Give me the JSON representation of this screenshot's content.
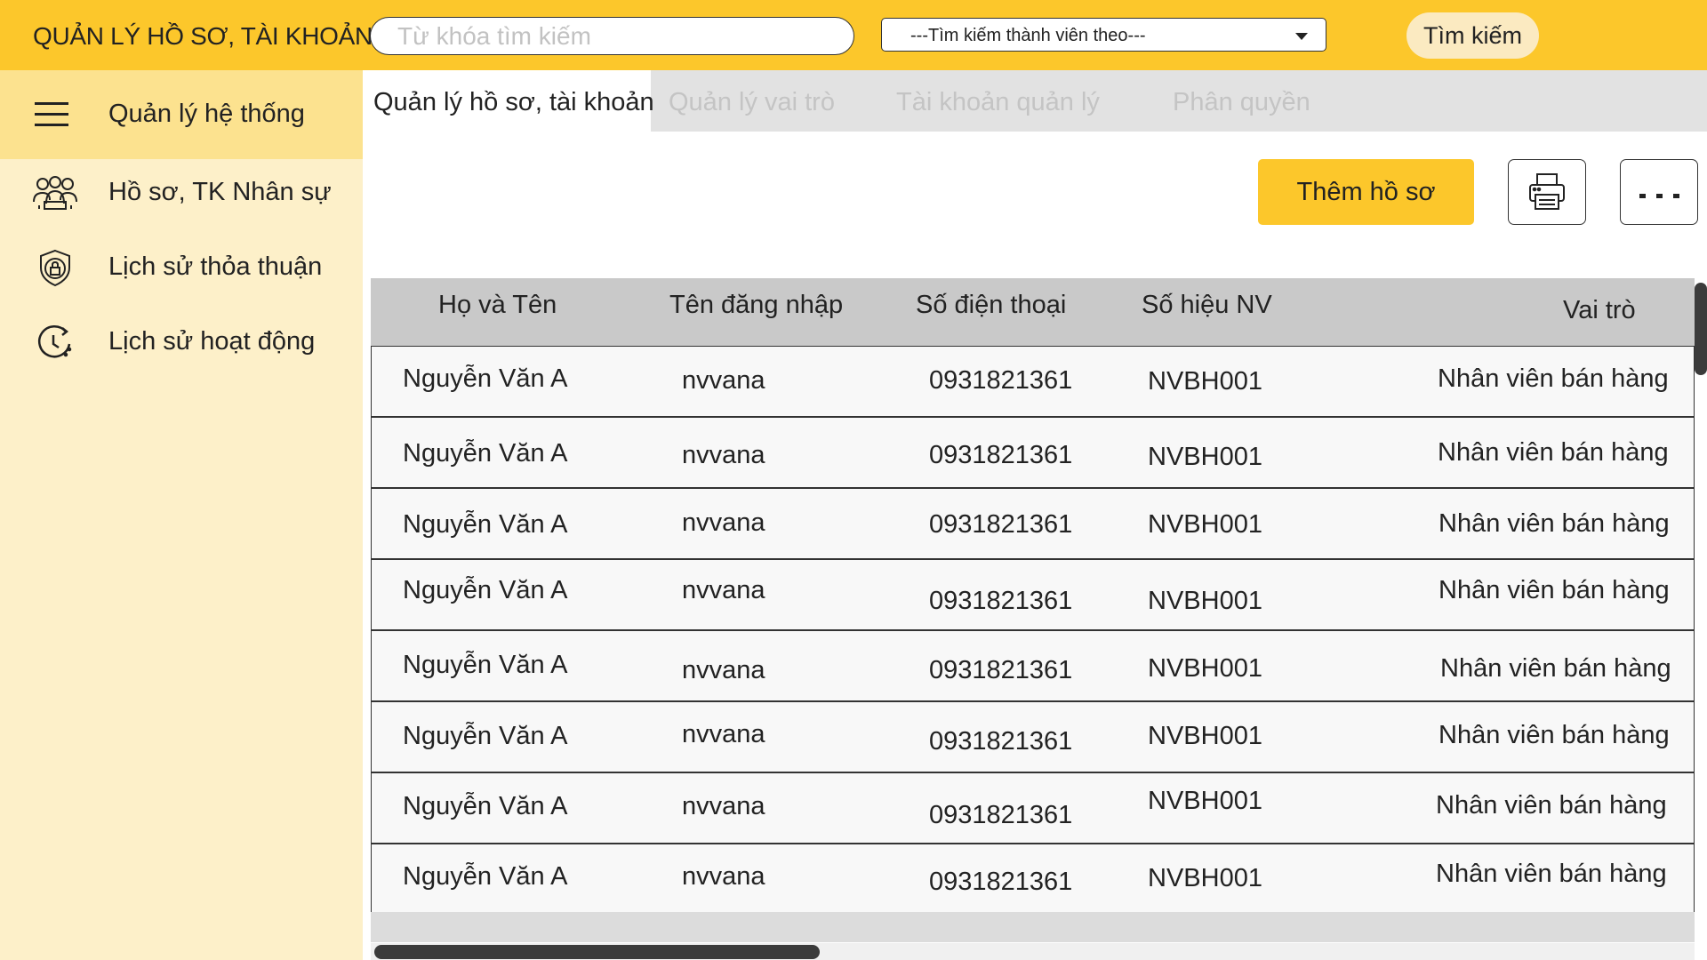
{
  "header": {
    "title": "QUẢN LÝ HỒ SƠ, TÀI KHOẢN",
    "search_placeholder": "Từ khóa tìm kiếm",
    "member_select_value": "---Tìm kiếm thành viên theo---",
    "search_button": "Tìm kiếm"
  },
  "sidebar": {
    "items": [
      {
        "label": "Quản lý hệ thống",
        "icon": "hamburger-menu-icon",
        "active": true
      },
      {
        "label": "Hồ sơ, TK Nhân sự",
        "icon": "staff-group-icon",
        "active": false
      },
      {
        "label": "Lịch sử thỏa thuận",
        "icon": "shield-lock-icon",
        "active": false
      },
      {
        "label": "Lịch sử hoạt động",
        "icon": "history-clock-icon",
        "active": false
      }
    ]
  },
  "tabs": [
    {
      "label": "Quản lý hồ sơ, tài khoản",
      "active": true
    },
    {
      "label": "Quản lý vai trò",
      "active": false
    },
    {
      "label": "Tài khoản quản lý",
      "active": false
    },
    {
      "label": "Phân quyền",
      "active": false
    }
  ],
  "toolbar": {
    "add_label": "Thêm hồ sơ",
    "print_icon": "printer-icon",
    "more_icon": "more-options-icon"
  },
  "table": {
    "columns": [
      "Họ và Tên",
      "Tên đăng nhập",
      "Số điện thoại",
      "Số hiệu NV",
      "Vai trò"
    ],
    "rows": [
      [
        "Nguyễn Văn A",
        "nvvana",
        "0931821361",
        "NVBH001",
        "Nhân viên bán hàng"
      ],
      [
        "Nguyễn Văn A",
        "nvvana",
        "0931821361",
        "NVBH001",
        "Nhân viên bán hàng"
      ],
      [
        "Nguyễn Văn A",
        "nvvana",
        "0931821361",
        "NVBH001",
        "Nhân viên bán hàng"
      ],
      [
        "Nguyễn Văn A",
        "nvvana",
        "0931821361",
        "NVBH001",
        "Nhân viên bán hàng"
      ],
      [
        "Nguyễn Văn A",
        "nvvana",
        "0931821361",
        "NVBH001",
        "Nhân viên bán hàng"
      ],
      [
        "Nguyễn Văn A",
        "nvvana",
        "0931821361",
        "NVBH001",
        "Nhân viên bán hàng"
      ],
      [
        "Nguyễn Văn A",
        "nvvana",
        "0931821361",
        "NVBH001",
        "Nhân viên bán hàng"
      ],
      [
        "Nguyễn Văn A",
        "nvvana",
        "0931821361",
        "NVBH001",
        "Nhân viên bán hàng"
      ]
    ]
  },
  "colors": {
    "brand_yellow": "#fcc72b",
    "sidebar_bg": "#fdf0c9",
    "sidebar_active": "#fce28f",
    "search_button_bg": "#fbeac1",
    "table_header_bg": "#c9c9c9",
    "tab_bar_bg": "#e2e2e2"
  }
}
